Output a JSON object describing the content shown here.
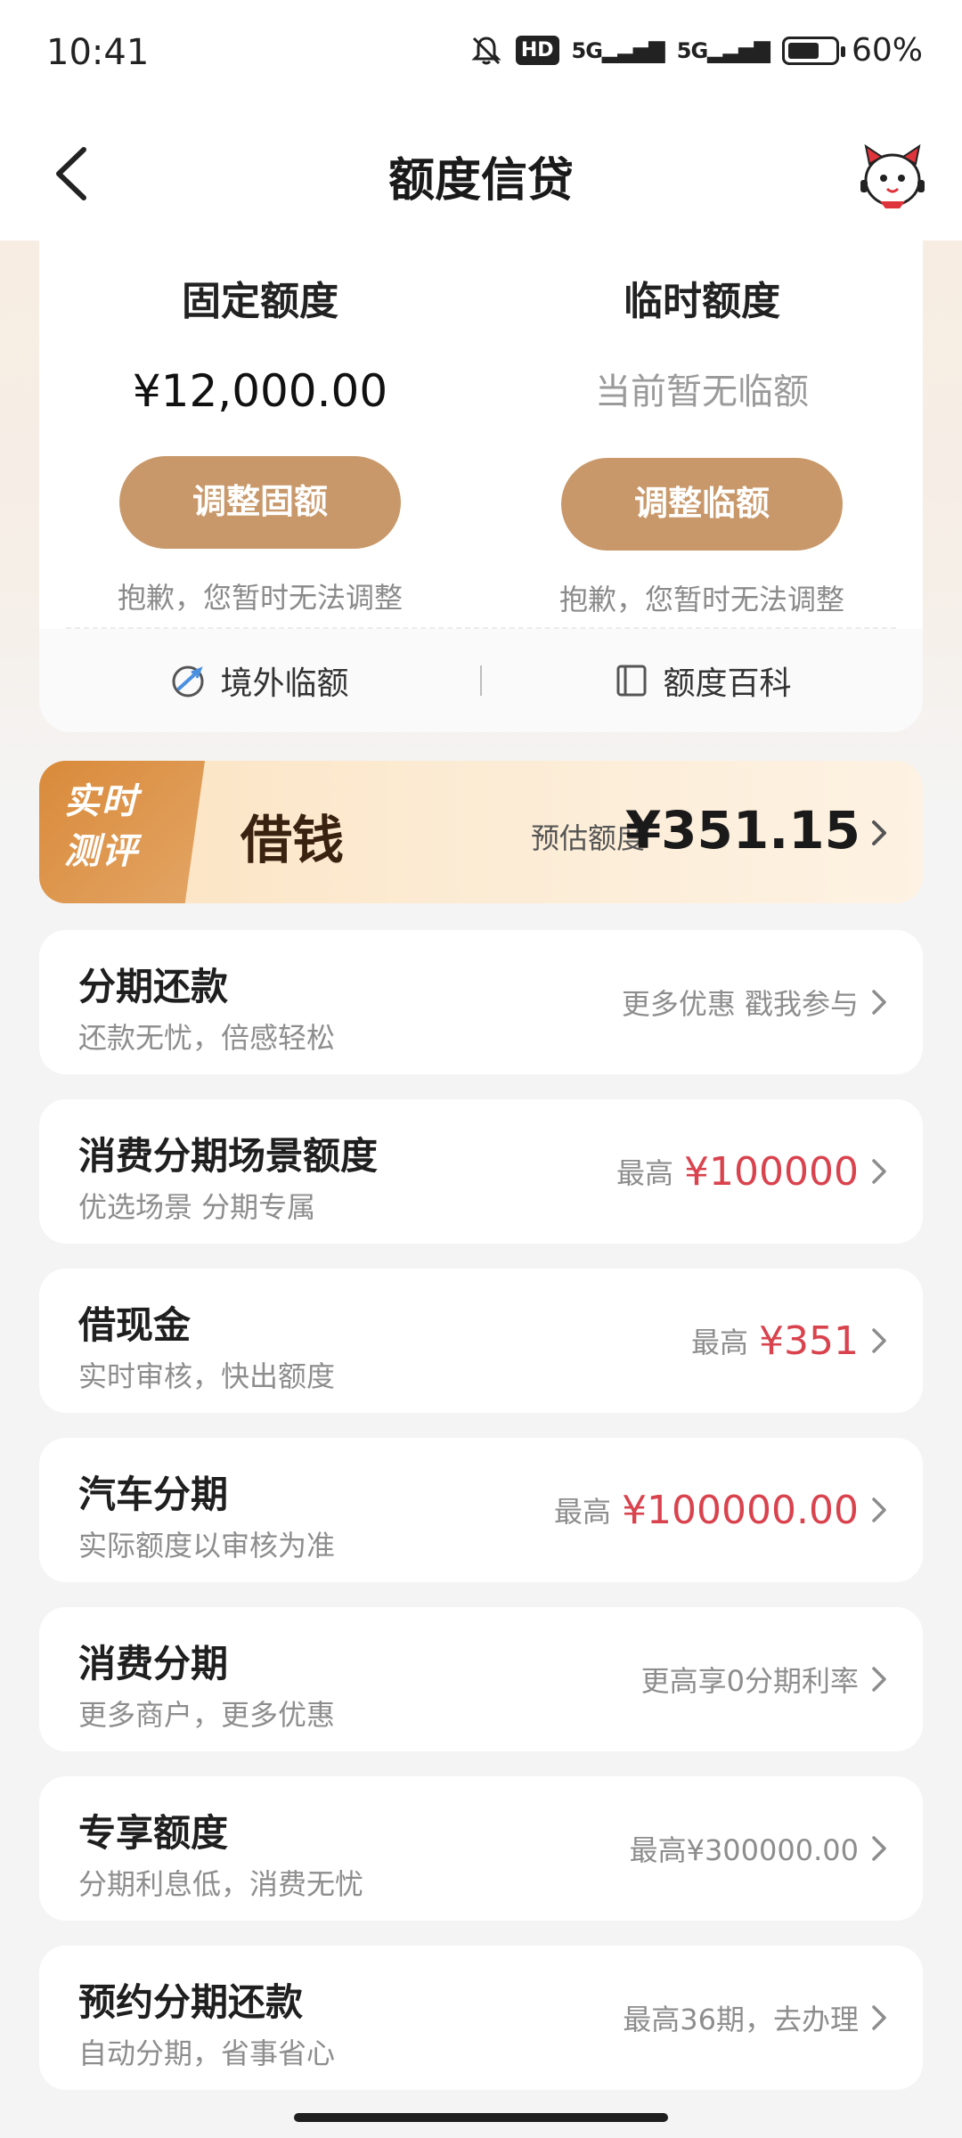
{
  "status_bar": {
    "time": "10:41",
    "hd": "HD",
    "net1": "5G",
    "net2": "5G",
    "battery": "60%"
  },
  "nav": {
    "title": "额度信贷"
  },
  "quota": {
    "fixed": {
      "title": "固定额度",
      "amount": "¥12,000.00",
      "button": "调整固额",
      "note": "抱歉，您暂时无法调整"
    },
    "temp": {
      "title": "临时额度",
      "amount": "当前暂无临额",
      "button": "调整临额",
      "note": "抱歉，您暂时无法调整"
    },
    "links": {
      "overseas": "境外临额",
      "wiki": "额度百科"
    }
  },
  "borrow": {
    "tag": "实时测评",
    "title": "借钱",
    "est_label": "预估额度",
    "est_value": "¥351.15"
  },
  "items": [
    {
      "title": "分期还款",
      "sub": "还款无忧，倍感轻松",
      "label": "更多优惠 戳我参与",
      "value": ""
    },
    {
      "title": "消费分期场景额度",
      "sub": "优选场景 分期专属",
      "label": "最高",
      "value": "¥100000"
    },
    {
      "title": "借现金",
      "sub": "实时审核，快出额度",
      "label": "最高",
      "value": "¥351"
    },
    {
      "title": "汽车分期",
      "sub": "实际额度以审核为准",
      "label": "最高",
      "value": "¥100000.00"
    },
    {
      "title": "消费分期",
      "sub": "更多商户，更多优惠",
      "label": "更高享0分期利率",
      "value": ""
    },
    {
      "title": "专享额度",
      "sub": "分期利息低，消费无忧",
      "label": "最高¥300000.00",
      "value": ""
    },
    {
      "title": "预约分期还款",
      "sub": "自动分期，省事省心",
      "label": "最高36期，去办理",
      "value": ""
    }
  ],
  "colors": {
    "accent_button": "#c8986a",
    "highlight_red": "#d9434e",
    "banner_tag": "#d98a3a"
  },
  "icons": [
    "back-icon",
    "mascot-icon",
    "mute-icon",
    "battery-icon",
    "globe-plane-icon",
    "book-icon",
    "chevron-right-icon"
  ]
}
